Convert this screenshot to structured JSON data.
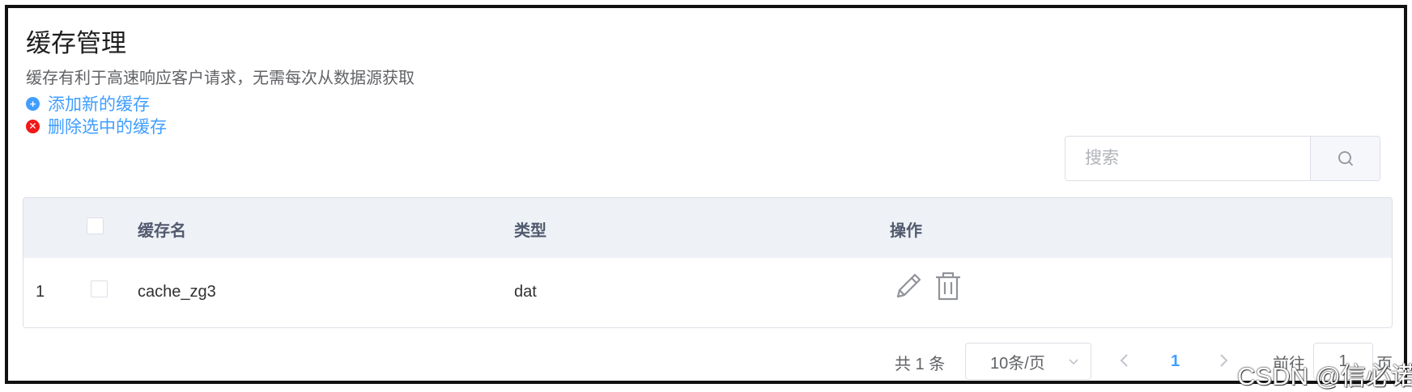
{
  "page": {
    "title": "缓存管理",
    "subtitle": "缓存有利于高速响应客户请求，无需每次从数据源获取"
  },
  "actions": {
    "add_label": "添加新的缓存",
    "delete_label": "删除选中的缓存"
  },
  "search": {
    "placeholder": "搜索",
    "value": ""
  },
  "table": {
    "columns": [
      "缓存名",
      "类型",
      "操作"
    ],
    "rows": [
      {
        "index": "1",
        "name": "cache_zg3",
        "type": "dat",
        "checked": false
      }
    ]
  },
  "pagination": {
    "total_text": "共 1 条",
    "page_size": "10条/页",
    "current_page": "1",
    "goto_prefix": "前往",
    "goto_value": "1",
    "goto_suffix": "页"
  },
  "watermark": "CSDN @信必诺",
  "colors": {
    "link": "#409eff",
    "danger": "#f01818",
    "header_bg": "#eef1f6"
  },
  "icons": [
    "plus-circle-icon",
    "close-circle-icon",
    "search-icon",
    "edit-icon",
    "trash-icon",
    "chevron-down-icon",
    "chevron-left-icon",
    "chevron-right-icon"
  ]
}
